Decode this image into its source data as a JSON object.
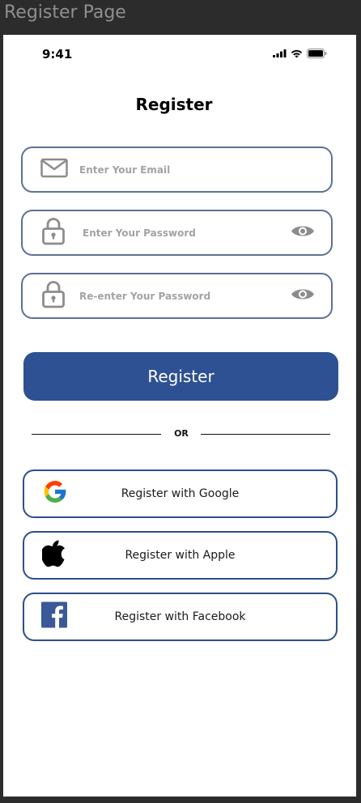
{
  "frame_title": "Register Page",
  "status_bar": {
    "time": "9:41"
  },
  "page": {
    "title": "Register"
  },
  "fields": {
    "email_placeholder": "Enter Your Email",
    "password_placeholder": "Enter Your Password",
    "confirm_password_placeholder": "Re-enter Your Password"
  },
  "register_button_label": "Register",
  "divider_text": "OR",
  "social": {
    "google": "Register with Google",
    "apple": "Register with Apple",
    "facebook": "Register with Facebook"
  },
  "colors": {
    "primary": "#2e5193",
    "field_border": "#5d7195",
    "social_border": "#2d4f8a",
    "placeholder": "#a3a3a3",
    "facebook": "#3b5998"
  },
  "icons": [
    "mail-icon",
    "lock-icon",
    "eye-icon",
    "google-icon",
    "apple-icon",
    "facebook-icon",
    "signal-icon",
    "wifi-icon",
    "battery-icon"
  ]
}
